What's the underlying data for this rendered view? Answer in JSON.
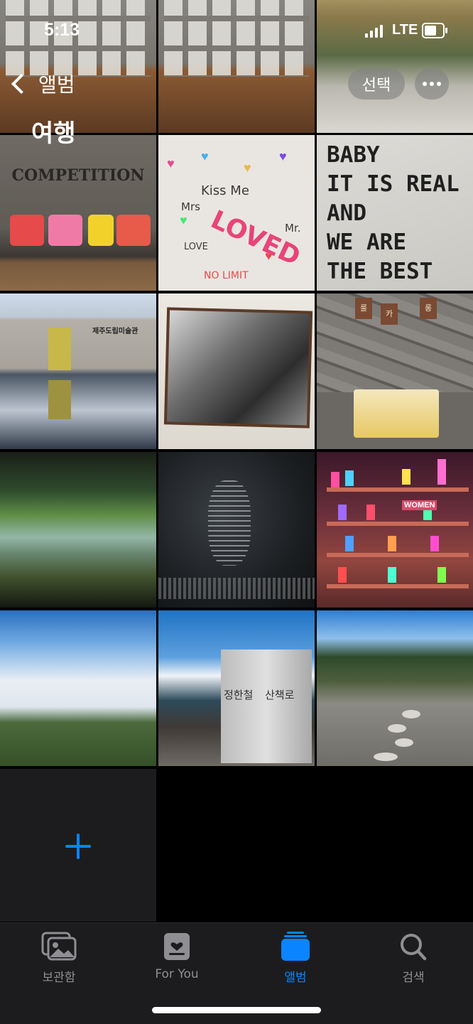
{
  "status_bar": {
    "time": "5:13",
    "network": "LTE"
  },
  "header": {
    "back_label": "앨범",
    "album_title": "여행",
    "select_label": "선택",
    "more_icon": "ellipsis-icon"
  },
  "photos": [
    {
      "id": "gallery-wall-1"
    },
    {
      "id": "gallery-wall-2"
    },
    {
      "id": "courtyard"
    },
    {
      "id": "competition-love-tvs",
      "text": "COMPETITION"
    },
    {
      "id": "graffiti-love-wall",
      "texts": [
        "Kiss Me",
        "Mrs",
        "Mr.",
        "LOVE",
        "LOVED",
        "NO LIMIT"
      ]
    },
    {
      "id": "baby-wall",
      "text": "BABY\nIT IS REAL\nAND\nWE ARE\nTHE BEST"
    },
    {
      "id": "jeju-museum",
      "text": "제주도립미술관"
    },
    {
      "id": "framed-photo"
    },
    {
      "id": "stone-wall-display",
      "texts": [
        "룰",
        "카",
        "롱"
      ]
    },
    {
      "id": "forest-screen"
    },
    {
      "id": "dark-text-room"
    },
    {
      "id": "neon-bookshelf",
      "text": "WOMEN"
    },
    {
      "id": "cloudy-sky"
    },
    {
      "id": "coast-stele",
      "texts": [
        "정한철",
        "산책로"
      ]
    },
    {
      "id": "garden-path"
    }
  ],
  "add_tile": {
    "icon": "plus-icon",
    "accent": "#0a84ff"
  },
  "tabbar": {
    "active_color": "#0a84ff",
    "items": [
      {
        "label": "보관함",
        "icon": "photo-library-icon"
      },
      {
        "label": "For You",
        "icon": "for-you-icon"
      },
      {
        "label": "앨범",
        "icon": "albums-icon"
      },
      {
        "label": "검색",
        "icon": "search-icon"
      }
    ]
  }
}
